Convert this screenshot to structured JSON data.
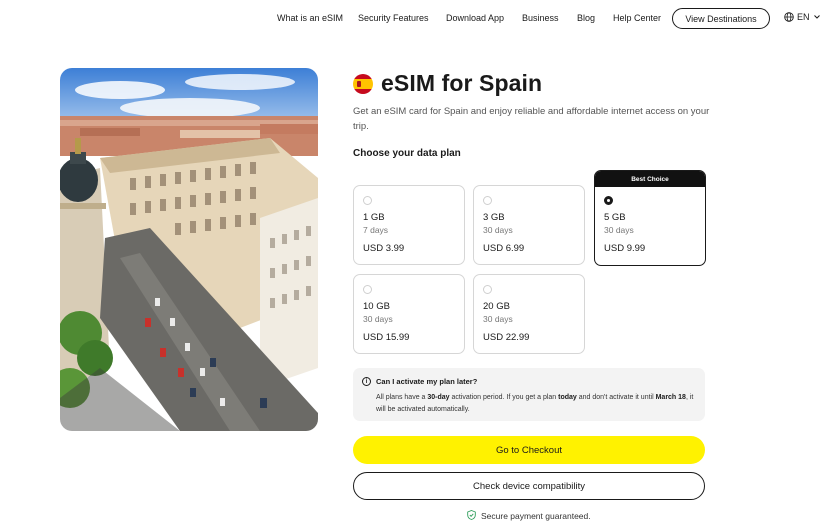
{
  "nav": {
    "links": [
      "What is an eSIM",
      "Security Features",
      "Download App",
      "Business",
      "Blog",
      "Help Center"
    ],
    "cta": "View Destinations",
    "lang": "EN"
  },
  "product": {
    "title": "eSIM for Spain",
    "description": "Get an eSIM card for Spain and enjoy reliable and affordable internet access on your trip.",
    "choose_label": "Choose your data plan"
  },
  "plans": [
    {
      "gb": "1 GB",
      "days": "7 days",
      "price": "USD 3.99"
    },
    {
      "gb": "3 GB",
      "days": "30 days",
      "price": "USD 6.99"
    },
    {
      "gb": "5 GB",
      "days": "30 days",
      "price": "USD 9.99",
      "badge": "Best Choice",
      "selected": true
    },
    {
      "gb": "10 GB",
      "days": "30 days",
      "price": "USD 15.99"
    },
    {
      "gb": "20 GB",
      "days": "30 days",
      "price": "USD 22.99"
    }
  ],
  "info": {
    "question": "Can I activate my plan later?",
    "a1": "All plans have a ",
    "a2": "30-day",
    "a3": " activation period. If you get a plan ",
    "a4": "today",
    "a5": " and don't activate it until ",
    "a6": "March 18",
    "a7": ", it will be activated automatically."
  },
  "buttons": {
    "checkout": "Go to Checkout",
    "compat": "Check device compatibility"
  },
  "secure_text": "Secure payment guaranteed.",
  "colors": {
    "accent_yellow": "#fff200",
    "dark": "#1a1a1a",
    "secure_green": "#2e9e5b"
  }
}
